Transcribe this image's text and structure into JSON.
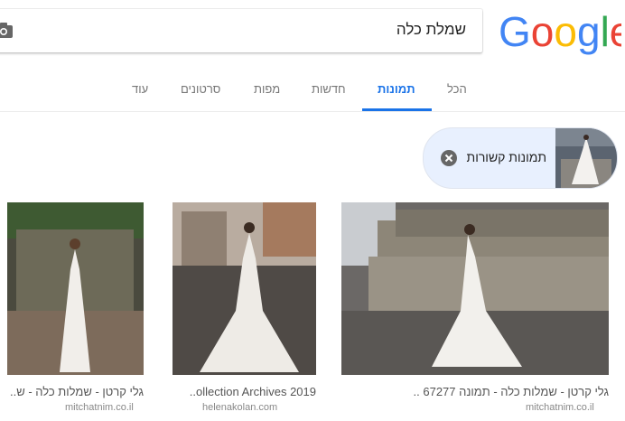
{
  "search": {
    "query": "שמלת כלה"
  },
  "logo_text": "Google",
  "tabs": [
    {
      "label": "הכל",
      "active": false
    },
    {
      "label": "תמונות",
      "active": true
    },
    {
      "label": "חדשות",
      "active": false
    },
    {
      "label": "מפות",
      "active": false
    },
    {
      "label": "סרטונים",
      "active": false
    },
    {
      "label": "עוד",
      "active": false
    }
  ],
  "related_chip": {
    "label": "תמונות קשורות"
  },
  "results": [
    {
      "caption": "גלי קרטן - שמלות כלה - תמונה 67277 ..",
      "domain": "mitchatnim.co.il"
    },
    {
      "caption": "..ollection Archives 2019",
      "domain": "helenakolan.com"
    },
    {
      "caption": "גלי קרטן - שמלות כלה - ש..",
      "domain": "mitchatnim.co.il"
    }
  ],
  "colors": {
    "accent": "#1a73e8",
    "chip_bg": "#e8f0fe"
  },
  "icons": [
    "camera-icon",
    "close-icon"
  ]
}
